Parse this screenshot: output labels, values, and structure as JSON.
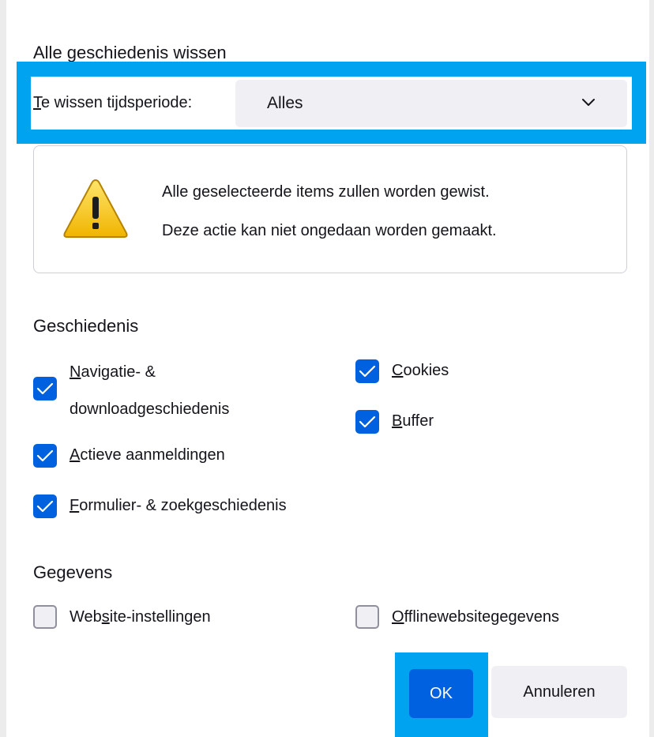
{
  "dialog": {
    "title": "Alle geschiedenis wissen"
  },
  "period": {
    "label_key": "T",
    "label_rest": "e wissen tijdsperiode:",
    "selected": "Alles"
  },
  "warning": {
    "line1": "Alle geselecteerde items zullen worden gewist.",
    "line2": "Deze actie kan niet ongedaan worden gemaakt."
  },
  "history": {
    "heading": "Geschiedenis",
    "items": [
      {
        "key": "N",
        "line1": "avigatie- &",
        "line2": "downloadgeschiedenis",
        "checked": true
      },
      {
        "key": "C",
        "rest": "ookies",
        "checked": true
      },
      {
        "key": "B",
        "rest": "uffer",
        "checked": true
      },
      {
        "key": "A",
        "rest": "ctieve aanmeldingen",
        "checked": true
      },
      {
        "key": "F",
        "rest": "ormulier- & zoekgeschiedenis",
        "checked": true
      }
    ]
  },
  "data_section": {
    "heading": "Gegevens",
    "items": [
      {
        "before": "Web",
        "key": "s",
        "after": "ite-instellingen",
        "checked": false
      },
      {
        "key": "O",
        "rest": "fflinewebsitegegevens",
        "checked": false
      }
    ]
  },
  "buttons": {
    "ok": "OK",
    "cancel": "Annuleren"
  },
  "colors": {
    "accent": "#0061e0",
    "highlight": "#00a3f0"
  },
  "icons": [
    "warning-icon",
    "chevron-down-icon",
    "checkmark-icon"
  ]
}
